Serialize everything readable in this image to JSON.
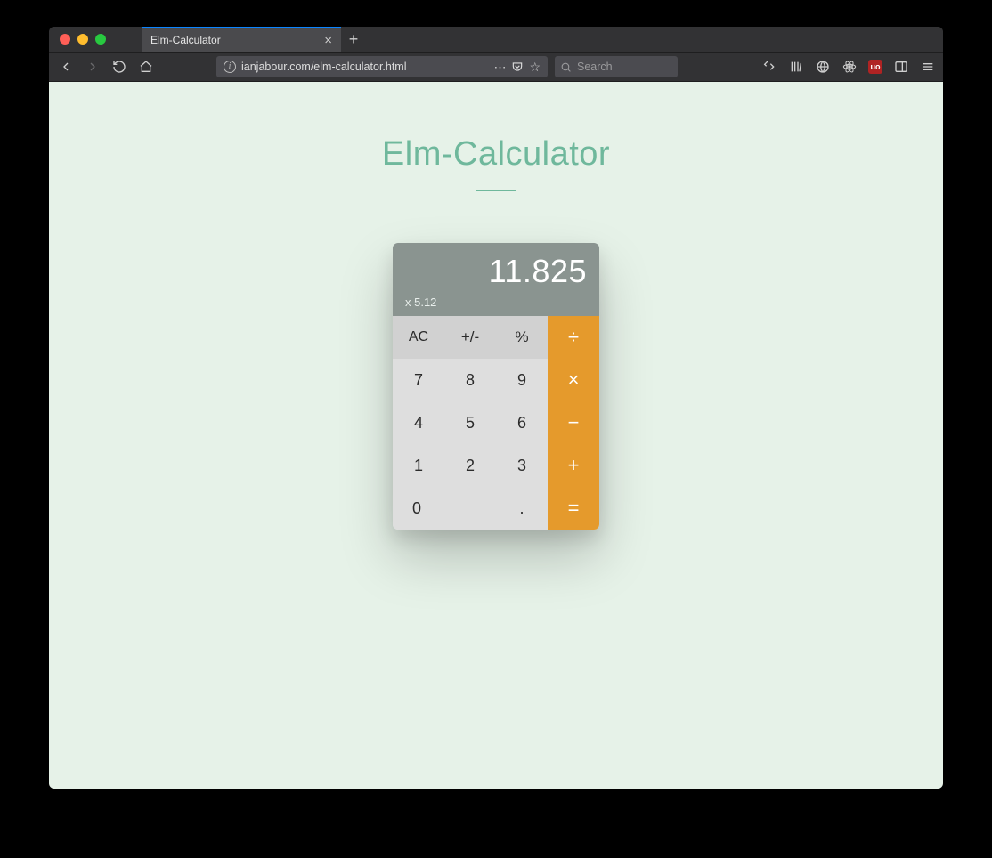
{
  "browser": {
    "tab_title": "Elm-Calculator",
    "url": "ianjabour.com/elm-calculator.html",
    "search_placeholder": "Search",
    "ublock_label": "uo"
  },
  "page": {
    "title": "Elm-Calculator"
  },
  "calculator": {
    "display_main": "11.825",
    "display_sub": "x 5.12",
    "keys": {
      "ac": "AC",
      "sign": "+/-",
      "percent": "%",
      "divide": "÷",
      "seven": "7",
      "eight": "8",
      "nine": "9",
      "multiply": "×",
      "four": "4",
      "five": "5",
      "six": "6",
      "minus": "−",
      "one": "1",
      "two": "2",
      "three": "3",
      "plus": "+",
      "zero": "0",
      "decimal": ".",
      "equals": "="
    }
  }
}
